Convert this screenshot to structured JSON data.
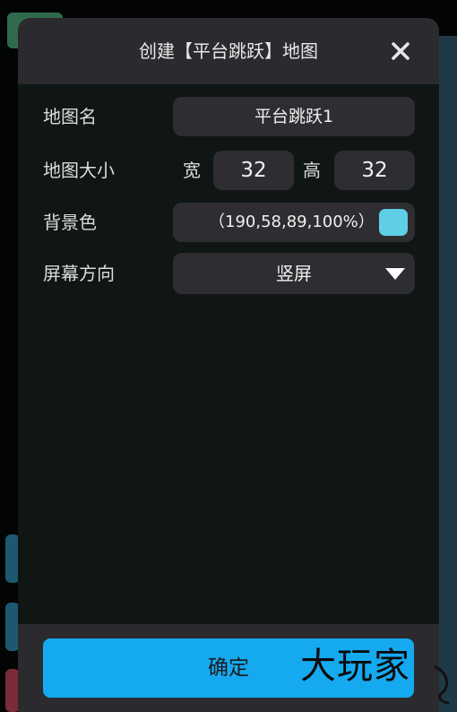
{
  "dialog": {
    "title": "创建【平台跳跃】地图",
    "close_icon": "close-icon"
  },
  "form": {
    "map_name": {
      "label": "地图名",
      "value": "平台跳跃1"
    },
    "map_size": {
      "label": "地图大小",
      "width_label": "宽",
      "width_value": "32",
      "height_label": "高",
      "height_value": "32"
    },
    "background_color": {
      "label": "背景色",
      "value": "（190,58,89,100%）",
      "swatch_color": "#5fcfe6"
    },
    "screen_orientation": {
      "label": "屏幕方向",
      "value": "竖屏",
      "arrow_icon": "triangle-down-icon"
    }
  },
  "footer": {
    "confirm_label": "确定"
  },
  "watermark": {
    "text": "大玩家"
  },
  "colors": {
    "header_bg": "#2b2a2e",
    "dialog_bg": "#101614",
    "field_bg": "#2e2d31",
    "accent": "#15a9f0"
  }
}
